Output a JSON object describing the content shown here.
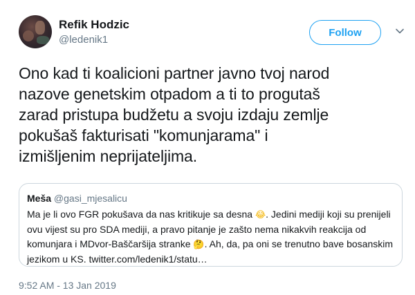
{
  "author": {
    "display_name": "Refik Hodzic",
    "handle": "@ledenik1"
  },
  "follow_button": {
    "label": "Follow"
  },
  "tweet": {
    "lines": [
      "Ono kad ti koalicioni partner javno tvoj narod",
      "nazove genetskim otpadom a ti to progutaš",
      "zarad pristupa budžetu a svoju izdaju zemlje",
      "pokušaš fakturisati \"komunjarama\" i",
      "izmišljenim neprijateljima."
    ]
  },
  "quoted_tweet": {
    "name": "Meša",
    "handle": "@gasi_mjesalicu",
    "line1": "Ma je li ovo FGR pokušava da nas kritikuje sa desna",
    "line1_end": ". Jedini mediji koji su prenijeli",
    "line2": "ovu vijest su pro SDA mediji, a pravo pitanje je zašto nema nikakvih reakcija od",
    "line3": "komunjara i MDvor-Baščaršija stranke",
    "line3_end": ". Ah, da, pa oni se trenutno bave bosanskim",
    "line4": "jezikom u KS. twitter.com/ledenik1/statu…",
    "emoji1": "laughing-emoji",
    "emoji2": "thinking-emoji"
  },
  "timestamp": "9:52 AM - 13 Jan 2019",
  "colors": {
    "accent": "#1da1f2",
    "text": "#14171a",
    "muted": "#657786",
    "border": "#ccd6dd"
  }
}
